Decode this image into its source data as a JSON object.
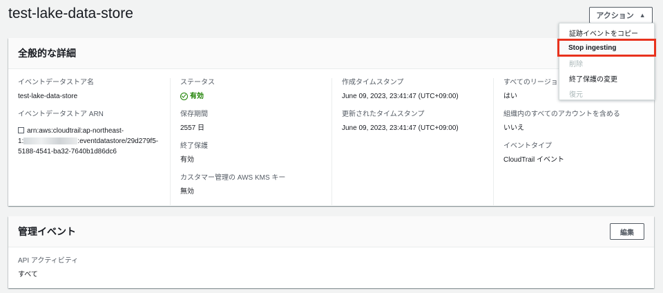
{
  "page": {
    "title": "test-lake-data-store"
  },
  "actions": {
    "label": "アクション"
  },
  "menu": {
    "items": [
      {
        "label": "証跡イベントをコピー",
        "state": "enabled"
      },
      {
        "label": "Stop ingesting",
        "state": "highlighted"
      },
      {
        "label": "削除",
        "state": "disabled"
      },
      {
        "label": "終了保護の変更",
        "state": "enabled"
      },
      {
        "label": "復元",
        "state": "disabled"
      }
    ]
  },
  "details": {
    "heading": "全般的な詳細",
    "col1": {
      "name_label": "イベントデータストア名",
      "name_value": "test-lake-data-store",
      "arn_label": "イベントデータストア ARN",
      "arn_line1": "arn:aws:cloudtrail:ap-northeast-",
      "arn_prefix": "1:",
      "arn_rest": ":eventdatastore/29d279f5-5188-4541-ba32-7640b1d86dc6"
    },
    "col2": {
      "status_label": "ステータス",
      "status_value": "有効",
      "retention_label": "保存期間",
      "retention_value": "2557 日",
      "termination_label": "終了保護",
      "termination_value": "有効",
      "kms_label": "カスタマー管理の AWS KMS キー",
      "kms_value": "無効"
    },
    "col3": {
      "created_label": "作成タイムスタンプ",
      "created_value": "June 09, 2023, 23:41:47 (UTC+09:00)",
      "updated_label": "更新されたタイムスタンプ",
      "updated_value": "June 09, 2023, 23:41:47 (UTC+09:00)"
    },
    "col4": {
      "regions_label": "すべてのリージョン",
      "regions_value": "はい",
      "org_label": "組織内のすべてのアカウントを含める",
      "org_value": "いいえ",
      "type_label": "イベントタイプ",
      "type_value": "CloudTrail イベント"
    }
  },
  "management": {
    "heading": "管理イベント",
    "edit_label": "編集",
    "api_label": "API アクティビティ",
    "api_value": "すべて"
  },
  "colors": {
    "success": "#1d8102",
    "highlight_border": "#e8321d"
  }
}
